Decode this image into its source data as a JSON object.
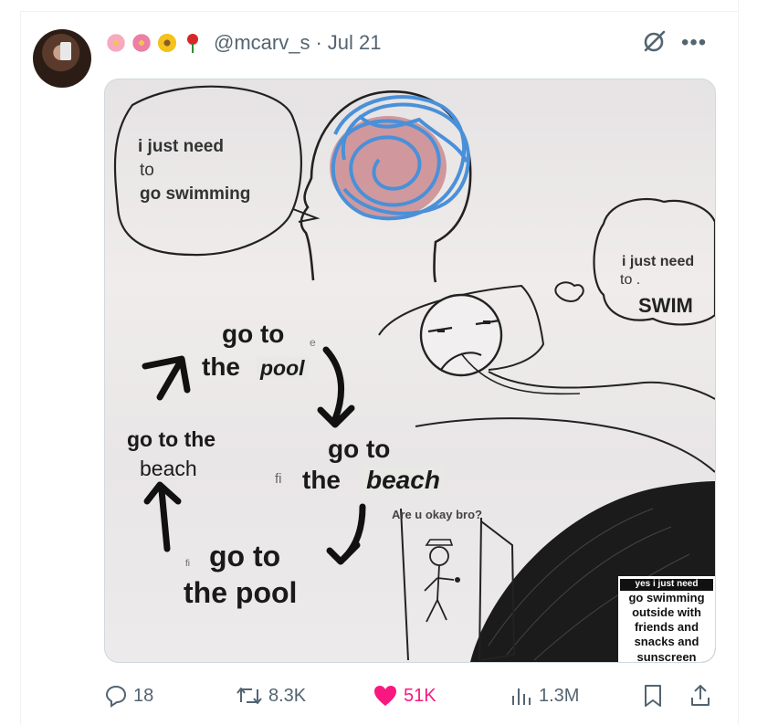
{
  "tweet": {
    "emojis": [
      "cherry-blossom",
      "pink-flower",
      "sunflower",
      "rose"
    ],
    "handle": "@mcarv_s",
    "separator": "·",
    "date": "Jul 21"
  },
  "meme": {
    "thought_left": [
      "i just need",
      "to",
      "go swimming"
    ],
    "thought_right_line1": "i just need",
    "thought_right_line2": "to .",
    "thought_right_line3": "SWIM",
    "cycle_top_a": "go to",
    "cycle_top_b": "the",
    "cycle_top_c": "pool",
    "cycle_right_a": "go to",
    "cycle_right_b": "the",
    "cycle_right_c": "beach",
    "cycle_bottom_a": "go to",
    "cycle_bottom_b": "the pool",
    "cycle_left_a": "go to the",
    "cycle_left_b": "beach",
    "stray_e": "e",
    "stray_fi1": "fi",
    "stray_fi2": "fi",
    "doorway_question": "Are u okay bro?",
    "reply_overline": "yes i just need",
    "reply_lines": [
      "go swimming",
      "outside with",
      "friends and",
      "snacks and",
      "sunscreen"
    ]
  },
  "stats": {
    "replies": "18",
    "reposts": "8.3K",
    "likes": "51K",
    "views": "1.3M"
  },
  "colors": {
    "like": "#f91880",
    "muted": "#536471",
    "scribble": "#4a90d9"
  }
}
